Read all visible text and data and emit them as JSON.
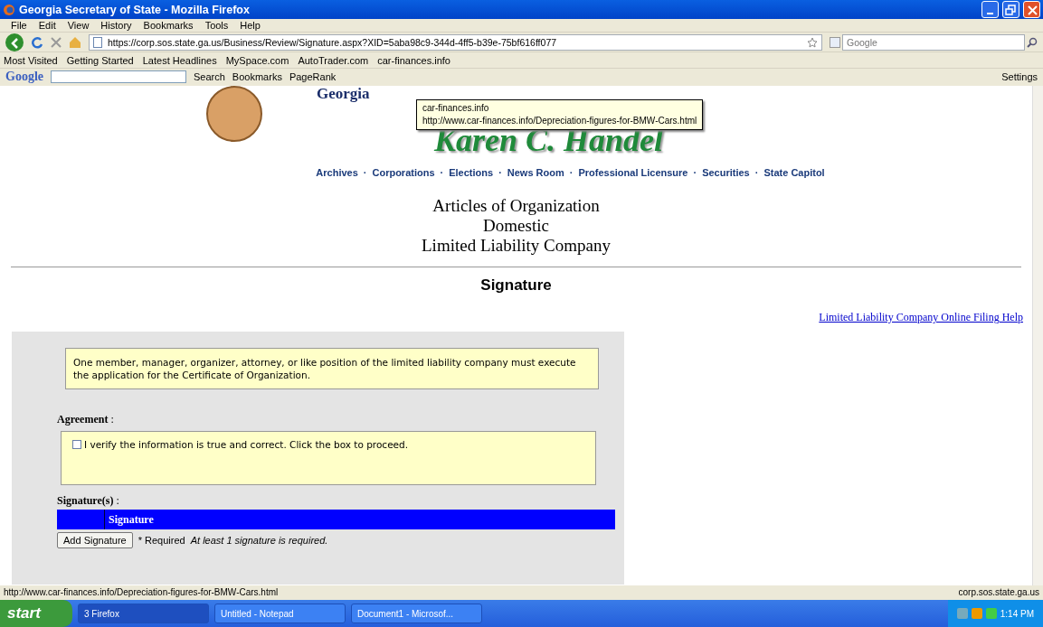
{
  "window": {
    "title": "Georgia Secretary of State - Mozilla Firefox"
  },
  "menu": [
    "File",
    "Edit",
    "View",
    "History",
    "Bookmarks",
    "Tools",
    "Help"
  ],
  "navbar": {
    "url": "https://corp.sos.state.ga.us/Business/Review/Signature.aspx?XID=5aba98c9-344d-4ff5-b39e-75bf616ff077",
    "search_placeholder": "Google"
  },
  "bookmarks": [
    "Most Visited",
    "Getting Started",
    "Latest Headlines",
    "MySpace.com",
    "AutoTrader.com",
    "car-finances.info"
  ],
  "google_toolbar": {
    "logo": "Google",
    "search_label": "Search",
    "bookmarks_label": "Bookmarks",
    "pagerank_label": "PageRank",
    "settings_label": "Settings"
  },
  "tooltip": {
    "title": "car-finances.info",
    "url": "http://www.car-finances.info/Depreciation-figures-for-BMW-Cars.html"
  },
  "page": {
    "logo_text": "Georgia",
    "official_name": "Karen C. Handel",
    "nav_links": [
      "Archives",
      "Corporations",
      "Elections",
      "News Room",
      "Professional Licensure",
      "Securities",
      "State Capitol"
    ],
    "nav_separator": "·",
    "title_lines": [
      "Articles of Organization",
      "Domestic",
      "Limited Liability Company"
    ],
    "section_title": "Signature",
    "help_link": "Limited Liability Company Online Filing Help",
    "notice": "One member, manager, organizer, attorney, or like position of the limited liability company must execute the application for the Certificate of Organization.",
    "agreement_label": "**Agreement** :",
    "agreement_checkbox": {
      "label": "I verify the information is true and correct. Click the box to proceed.",
      "checked": false
    },
    "signatures_label": "**Signature(s)** :",
    "signature_table": {
      "columns": [
        "Signature"
      ]
    },
    "add_button": "Add Signature",
    "required_label": "* Required",
    "required_note": "At least 1 signature is required."
  },
  "status_bar": {
    "text": "http://www.car-finances.info/Depreciation-figures-for-BMW-Cars.html",
    "domain": "corp.sos.state.ga.us"
  },
  "taskbar": {
    "start": "start",
    "tasks": [
      {
        "label": "3 Firefox",
        "selected": true
      },
      {
        "label": "Untitled - Notepad",
        "selected": false
      },
      {
        "label": "Document1 - Microsof...",
        "selected": false
      }
    ],
    "clock": "1:14 PM"
  }
}
